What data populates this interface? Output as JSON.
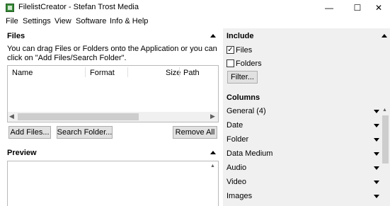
{
  "window": {
    "title": "FilelistCreator - Stefan Trost Media",
    "minimize": "—",
    "maximize": "☐",
    "close": "✕"
  },
  "menu": [
    "File",
    "Settings",
    "View",
    "Software",
    "Info & Help"
  ],
  "files": {
    "title": "Files",
    "hint": "You can drag Files or Folders onto the Application or you can click on \"Add Files/Search Folder\".",
    "columns": [
      "Name",
      "Format",
      "Size",
      "Path"
    ],
    "buttons": {
      "add_files": "Add Files...",
      "search_folder": "Search Folder...",
      "remove_all": "Remove All"
    }
  },
  "preview": {
    "title": "Preview"
  },
  "include": {
    "title": "Include",
    "files_label": "Files",
    "files_checked": true,
    "folders_label": "Folders",
    "folders_checked": false,
    "filter_button": "Filter..."
  },
  "columns_panel": {
    "title": "Columns",
    "items": [
      "General (4)",
      "Date",
      "Folder",
      "Data Medium",
      "Audio",
      "Video",
      "Images"
    ]
  }
}
